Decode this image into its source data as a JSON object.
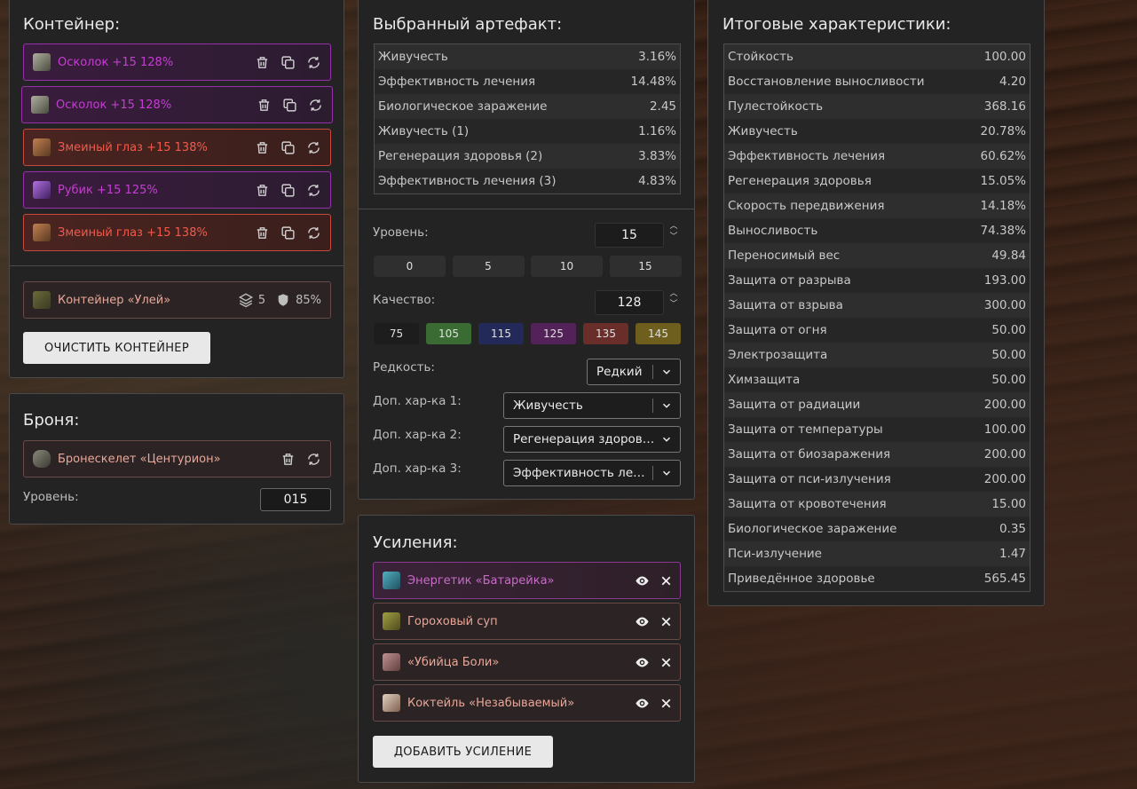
{
  "container": {
    "title": "Контейнер:",
    "items": [
      {
        "name": "Осколок +15 128%",
        "style": "purple",
        "icon": "shard-icon"
      },
      {
        "name": "Осколок +15 128%",
        "style": "purple",
        "icon": "shard-icon"
      },
      {
        "name": "Змеиный глаз +15 138%",
        "style": "red",
        "icon": "snake-eye-icon"
      },
      {
        "name": "Рубик +15 125%",
        "style": "purple",
        "icon": "rubik-icon"
      },
      {
        "name": "Змеиный глаз +15 138%",
        "style": "red",
        "icon": "snake-eye-icon"
      }
    ],
    "selected": {
      "name": "Контейнер «Улей»",
      "slots": "5",
      "protection": "85%"
    },
    "clear_label": "ОЧИСТИТЬ КОНТЕЙНЕР"
  },
  "armor": {
    "title": "Броня:",
    "item": "Бронескелет «Центурион»",
    "level_label": "Уровень:",
    "level_value": "015"
  },
  "artifact": {
    "title": "Выбранный артефакт:",
    "stats": [
      {
        "label": "Живучесть",
        "value": "3.16%",
        "color": "g"
      },
      {
        "label": "Эффективность лечения",
        "value": "14.48%",
        "color": "g"
      },
      {
        "label": "Биологическое заражение",
        "value": "2.45",
        "color": "r"
      },
      {
        "label": "Живучесть (1)",
        "value": "1.16%",
        "color": "g"
      },
      {
        "label": "Регенерация здоровья (2)",
        "value": "3.83%",
        "color": "g"
      },
      {
        "label": "Эффективность лечения (3)",
        "value": "4.83%",
        "color": "g"
      }
    ],
    "level_label": "Уровень:",
    "level_value": "15",
    "level_presets": [
      "0",
      "5",
      "10",
      "15"
    ],
    "quality_label": "Качество:",
    "quality_value": "128",
    "quality_presets": [
      {
        "label": "75",
        "color": "#1d1d1d"
      },
      {
        "label": "105",
        "color": "#3a6b32"
      },
      {
        "label": "115",
        "color": "#232a5a"
      },
      {
        "label": "125",
        "color": "#522258"
      },
      {
        "label": "135",
        "color": "#6a2e2a"
      },
      {
        "label": "145",
        "color": "#6e5f1e"
      }
    ],
    "rarity_label": "Редкость:",
    "rarity_value": "Редкий",
    "extra1_label": "Доп. хар-ка 1:",
    "extra1_value": "Живучесть",
    "extra2_label": "Доп. хар-ка 2:",
    "extra2_value": "Регенерация здоровья",
    "extra3_label": "Доп. хар-ка 3:",
    "extra3_value": "Эффективность лечения"
  },
  "boosts": {
    "title": "Усиления:",
    "items": [
      {
        "name": "Энергетик «Батарейка»",
        "style": "purple-soft",
        "icon": "energy-drink-icon"
      },
      {
        "name": "Гороховый суп",
        "style": "neutral",
        "icon": "pea-soup-icon"
      },
      {
        "name": "«Убийца Боли»",
        "style": "neutral",
        "icon": "painkiller-icon"
      },
      {
        "name": "Коктейль «Незабываемый»",
        "style": "neutral",
        "icon": "cocktail-icon"
      }
    ],
    "add_label": "ДОБАВИТЬ УСИЛЕНИЕ"
  },
  "totals": {
    "title": "Итоговые характеристики:",
    "stats": [
      {
        "label": "Стойкость",
        "value": "100.00",
        "color": "g"
      },
      {
        "label": "Восстановление выносливости",
        "value": "4.20",
        "color": "g"
      },
      {
        "label": "Пулестойкость",
        "value": "368.16",
        "color": "g"
      },
      {
        "label": "Живучесть",
        "value": "20.78%",
        "color": "g"
      },
      {
        "label": "Эффективность лечения",
        "value": "60.62%",
        "color": "g"
      },
      {
        "label": "Регенерация здоровья",
        "value": "15.05%",
        "color": "g"
      },
      {
        "label": "Скорость передвижения",
        "value": "14.18%",
        "color": "g"
      },
      {
        "label": "Выносливость",
        "value": "74.38%",
        "color": "g"
      },
      {
        "label": "Переносимый вес",
        "value": "49.84",
        "color": "g"
      },
      {
        "label": "Защита от разрыва",
        "value": "193.00",
        "color": "g"
      },
      {
        "label": "Защита от взрыва",
        "value": "300.00",
        "color": "g"
      },
      {
        "label": "Защита от огня",
        "value": "50.00",
        "color": "g"
      },
      {
        "label": "Электрозащита",
        "value": "50.00",
        "color": "g"
      },
      {
        "label": "Химзащита",
        "value": "50.00",
        "color": "g"
      },
      {
        "label": "Защита от радиации",
        "value": "200.00",
        "color": "g"
      },
      {
        "label": "Защита от температуры",
        "value": "100.00",
        "color": "g"
      },
      {
        "label": "Защита от биозаражения",
        "value": "200.00",
        "color": "g"
      },
      {
        "label": "Защита от пси-излучения",
        "value": "200.00",
        "color": "g"
      },
      {
        "label": "Защита от кровотечения",
        "value": "15.00",
        "color": "g"
      },
      {
        "label": "Биологическое заражение",
        "value": "0.35",
        "color": "r"
      },
      {
        "label": "Пси-излучение",
        "value": "1.47",
        "color": "r"
      },
      {
        "label": "Приведённое здоровье",
        "value": "565.45",
        "color": "y"
      }
    ]
  }
}
